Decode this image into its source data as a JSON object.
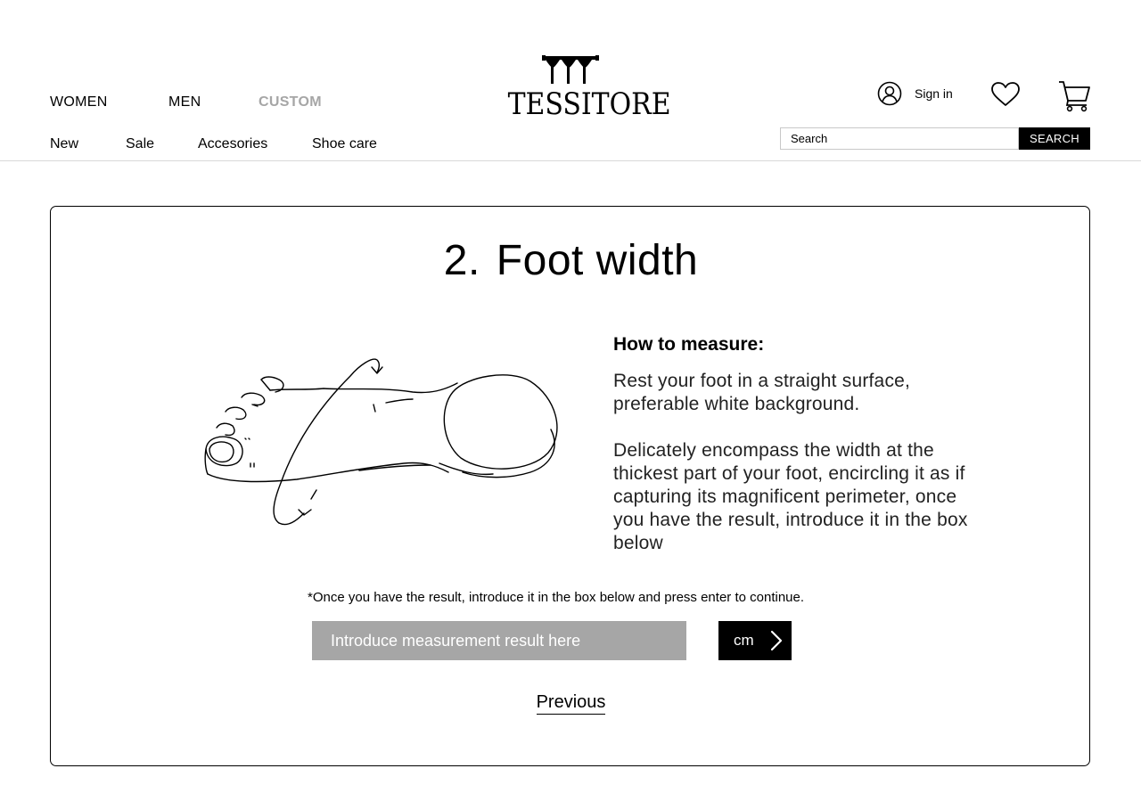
{
  "header": {
    "main_nav": [
      "WOMEN",
      "MEN",
      "CUSTOM"
    ],
    "sub_nav": [
      "New",
      "Sale",
      "Accesories",
      "Shoe care"
    ],
    "logo_text": "TESSITORE",
    "signin_label": "Sign in",
    "search": {
      "placeholder": "Search",
      "button_label": "SEARCH"
    },
    "icons": [
      "user-icon",
      "heart-icon",
      "cart-icon"
    ]
  },
  "step": {
    "number": "2.",
    "title": "Foot width",
    "howto_title": "How to measure:",
    "howto_paragraphs": [
      "Rest your foot in a straight surface, preferable white background.",
      "Delicately encompass the width at the thickest part of your foot, encircling it as if capturing its magnificent perimeter, once you have the result, introduce it in the box below"
    ],
    "note": "*Once you have the result, introduce it in the box below and press enter to continue.",
    "input_placeholder": "Introduce measurement result here",
    "unit_label": "cm",
    "previous_label": "Previous"
  },
  "colors": {
    "accent": "#000000",
    "muted": "#a6a6a6",
    "input_bg": "#a6a6a6"
  }
}
